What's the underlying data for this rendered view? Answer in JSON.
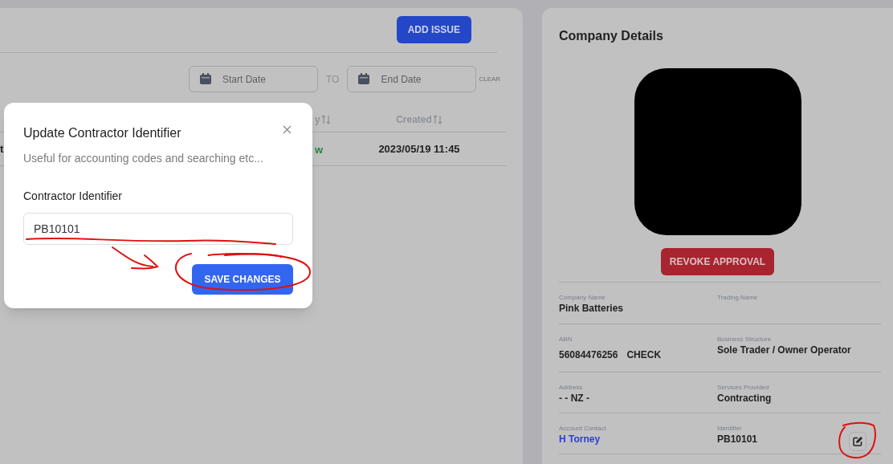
{
  "issues_panel": {
    "add_button": "ADD ISSUE",
    "date_filter": {
      "start": {
        "placeholder": "Start Date"
      },
      "separator": "TO",
      "end": {
        "placeholder": "End Date"
      },
      "clear": "CLEAR"
    },
    "table": {
      "columns": [
        {
          "label": "y"
        },
        {
          "label": "Created"
        }
      ],
      "rows": [
        {
          "column_1": "t",
          "status": "w",
          "color": "#1f8a3a",
          "created": "2023/05/19 11:45"
        }
      ]
    }
  },
  "dialog": {
    "title": "Update Contractor Identifier",
    "subtitle": "Useful for accounting codes and searching etc...",
    "field_label": "Contractor Identifier",
    "field_value": "PB10101",
    "save_button": "SAVE CHANGES"
  },
  "company": {
    "title": "Company Details",
    "revoke_button": "REVOKE APPROVAL",
    "rows": [
      [
        {
          "label": "Company Name",
          "value": "Pink Batteries"
        },
        {
          "label": "Trading Name"
        }
      ],
      [
        {
          "label": "ABN",
          "value": "56084476256",
          "action": "CHECK"
        },
        {
          "label": "Business Structure",
          "value": "Sole Trader / Owner Operator"
        }
      ],
      [
        {
          "label": "Address",
          "value": "- - NZ -"
        },
        {
          "label": "Services Provided",
          "value": "Contracting"
        }
      ],
      [
        {
          "label": "Account Contact",
          "value": "H Torney",
          "kind": "link"
        },
        {
          "label": "Identifier",
          "value": "PB10101",
          "editable": true
        }
      ]
    ]
  }
}
